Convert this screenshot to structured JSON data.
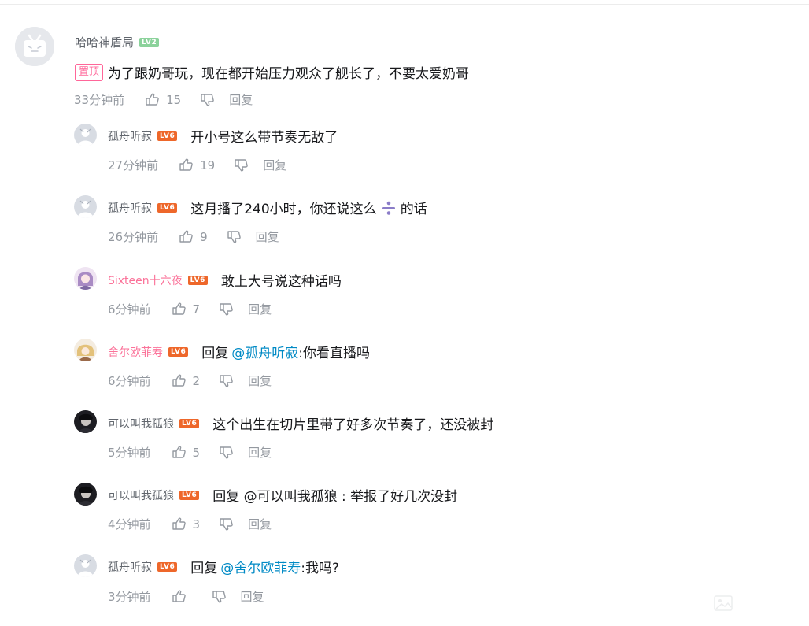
{
  "main_comment": {
    "username": "哈哈神盾局",
    "level": "LV2",
    "pin_tag": "置顶",
    "text": "为了跟奶哥玩，现在都开始压力观众了舰长了，不要太爱奶哥",
    "time": "33分钟前",
    "likes": "15",
    "reply_label": "回复"
  },
  "replies": [
    {
      "username": "孤舟听寂",
      "level": "LV6",
      "text": "开小号这么带节奏无敌了",
      "time": "27分钟前",
      "likes": "19",
      "reply_label": "回复"
    },
    {
      "username": "孤舟听寂",
      "level": "LV6",
      "text_before": "这月播了240小时，你还说这么",
      "emote": "divide-emote",
      "text_after": "的话",
      "time": "26分钟前",
      "likes": "9",
      "reply_label": "回复"
    },
    {
      "username": "Sixteen十六夜",
      "level": "LV6",
      "text": "敢上大号说这种话吗",
      "time": "6分钟前",
      "likes": "7",
      "reply_label": "回复"
    },
    {
      "username": "舍尔欧菲寿",
      "level": "LV6",
      "prefix": "回复",
      "mention": "@孤舟听寂",
      "text": ":你看直播吗",
      "time": "6分钟前",
      "likes": "2",
      "reply_label": "回复"
    },
    {
      "username": "可以叫我孤狼",
      "level": "LV6",
      "text": "这个出生在切片里带了好多次节奏了，还没被封",
      "time": "5分钟前",
      "likes": "5",
      "reply_label": "回复"
    },
    {
      "username": "可以叫我孤狼",
      "level": "LV6",
      "text": "回复 @可以叫我孤狼 : 举报了好几次没封",
      "time": "4分钟前",
      "likes": "3",
      "reply_label": "回复"
    },
    {
      "username": "孤舟听寂",
      "level": "LV6",
      "prefix": "回复",
      "mention": "@舍尔欧菲寿",
      "text": ":我吗?",
      "time": "3分钟前",
      "likes": "",
      "reply_label": "回复"
    }
  ],
  "colors": {
    "username_gray": "#61666d",
    "username_pink": "#fb7299",
    "meta_gray": "#9499a0",
    "mention_blue": "#008ac5",
    "pin_pink": "#ff6699",
    "lv2_green": "#8bd29b",
    "lv6_orange": "#ee672a"
  }
}
